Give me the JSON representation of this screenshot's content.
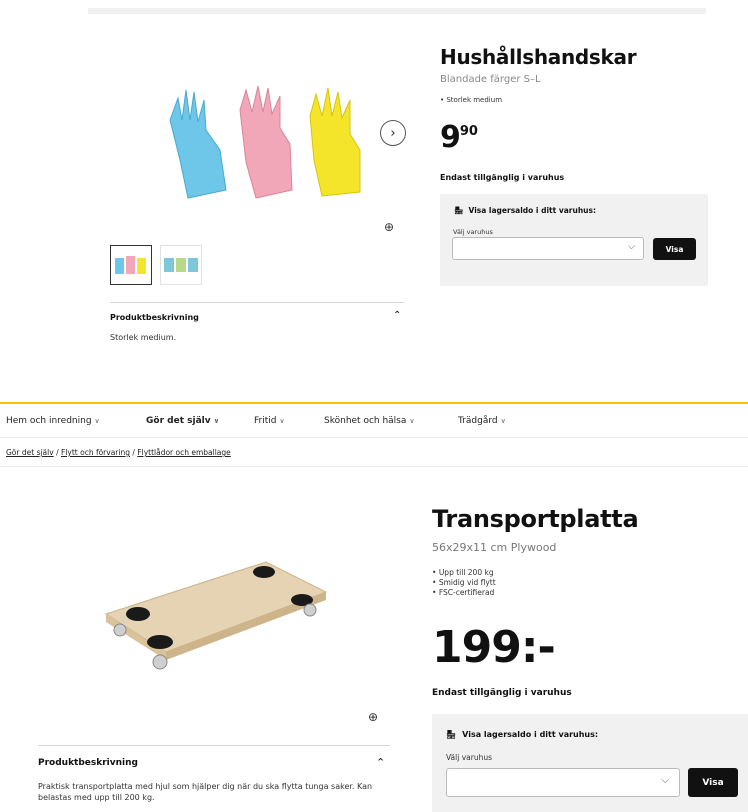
{
  "product1": {
    "title": "Hushållshandskar",
    "subtitle": "Blandade färger S–L",
    "bullet": "Storlek medium",
    "price_main": "9",
    "price_decimals": "90",
    "availability": "Endast tillgänglig i varuhus",
    "stock_heading": "Visa lagersaldo i ditt varuhus:",
    "store_label": "Välj varuhus",
    "store_value": "",
    "visa_label": "Visa",
    "desc_heading": "Produktbeskrivning",
    "desc_text": "Storlek medium.",
    "image_icon": "gloves-image",
    "next_icon": "chevron-right-icon",
    "zoom_icon": "zoom-in-icon"
  },
  "nav": {
    "items": [
      {
        "label": "Hem och inredning",
        "active": false
      },
      {
        "label": "Gör det själv",
        "active": true
      },
      {
        "label": "Fritid",
        "active": false
      },
      {
        "label": "Skönhet och hälsa",
        "active": false
      },
      {
        "label": "Trädgård",
        "active": false
      }
    ]
  },
  "breadcrumb": {
    "items": [
      "Gör det själv",
      "Flytt och förvaring",
      "Flyttlådor och emballage"
    ],
    "separator": "/"
  },
  "product2": {
    "title": "Transportplatta",
    "subtitle": "56x29x11 cm Plywood",
    "bullets": [
      "Upp till 200 kg",
      "Smidig vid flytt",
      "FSC-certifierad"
    ],
    "price": "199:-",
    "availability": "Endast tillgänglig i varuhus",
    "stock_heading": "Visa lagersaldo i ditt varuhus:",
    "store_label": "Välj varuhus",
    "store_value": "",
    "visa_label": "Visa",
    "desc_heading": "Produktbeskrivning",
    "desc_text": "Praktisk transportplatta med hjul som hjälper dig när du ska flytta tunga saker. Kan belastas med upp till 200 kg.",
    "image_icon": "dolly-image",
    "zoom_icon": "zoom-in-icon"
  },
  "colors": {
    "accent": "#f5c400",
    "button": "#111111",
    "panel": "#f1f1f1"
  }
}
